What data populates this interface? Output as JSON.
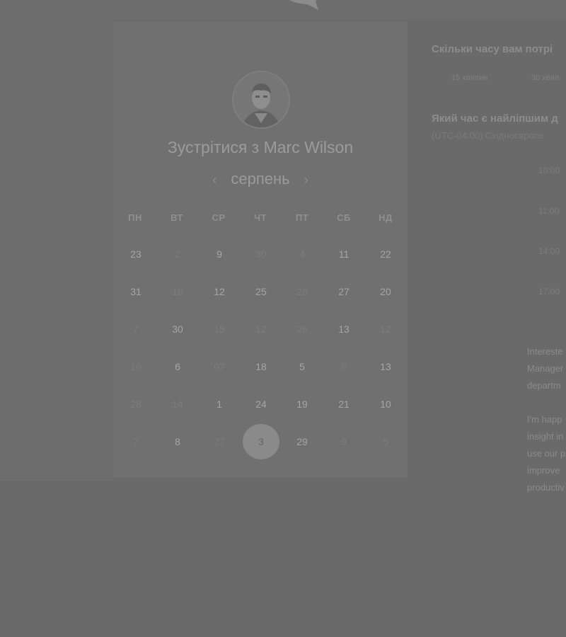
{
  "meeting": {
    "title": "Зустрітися з Marc Wilson"
  },
  "calendar": {
    "month": "серпень",
    "prev_icon": "chevron-left-icon",
    "next_icon": "chevron-right-icon",
    "weekdays": [
      "ПН",
      "ВТ",
      "СР",
      "ЧТ",
      "ПТ",
      "СБ",
      "НД"
    ],
    "weeks": [
      [
        {
          "label": "23",
          "dim": false
        },
        {
          "label": "2",
          "dim": true
        },
        {
          "label": "9",
          "dim": false
        },
        {
          "label": "30",
          "dim": true
        },
        {
          "label": "4",
          "dim": true
        },
        {
          "label": "11",
          "dim": false
        },
        {
          "label": "22",
          "dim": false
        }
      ],
      [
        {
          "label": "31",
          "dim": false
        },
        {
          "label": "16",
          "dim": true
        },
        {
          "label": "12",
          "dim": false
        },
        {
          "label": "25",
          "dim": false
        },
        {
          "label": "26",
          "dim": true
        },
        {
          "label": "27",
          "dim": false
        },
        {
          "label": "20",
          "dim": false
        }
      ],
      [
        {
          "label": "7",
          "dim": true
        },
        {
          "label": "30",
          "dim": false
        },
        {
          "label": "15",
          "dim": true
        },
        {
          "label": "12",
          "dim": true
        },
        {
          "label": "26",
          "dim": true
        },
        {
          "label": "13",
          "dim": false
        },
        {
          "label": "12",
          "dim": true
        }
      ],
      [
        {
          "label": "16",
          "dim": true
        },
        {
          "label": "6",
          "dim": false
        },
        {
          "label": "07",
          "dim": true
        },
        {
          "label": "18",
          "dim": false
        },
        {
          "label": "5",
          "dim": false
        },
        {
          "label": "8",
          "dim": true
        },
        {
          "label": "13",
          "dim": false
        }
      ],
      [
        {
          "label": "28",
          "dim": true
        },
        {
          "label": "14",
          "dim": true
        },
        {
          "label": "1",
          "dim": false
        },
        {
          "label": "24",
          "dim": false
        },
        {
          "label": "19",
          "dim": false
        },
        {
          "label": "21",
          "dim": false
        },
        {
          "label": "10",
          "dim": false
        }
      ],
      [
        {
          "label": "7",
          "dim": true
        },
        {
          "label": "8",
          "dim": false
        },
        {
          "label": "27",
          "dim": true
        },
        {
          "label": "3",
          "dim": false,
          "selected": true
        },
        {
          "label": "29",
          "dim": false
        },
        {
          "label": "9",
          "dim": true
        },
        {
          "label": "5",
          "dim": true
        }
      ]
    ]
  },
  "scheduler": {
    "duration_question": "Скільки часу вам потрі",
    "durations": [
      "15 хвилин",
      "30 хвил"
    ],
    "time_question": "Який час є найліпшим д",
    "timezone": "(UTC-04:00) Східноєвропе",
    "slots": [
      "10:00",
      "11:00",
      "14:00",
      "17:00"
    ]
  },
  "description": {
    "lines": [
      "Intereste",
      "Manager",
      "departm",
      "",
      "I'm happ",
      "insight in",
      "use our p",
      "improve",
      "productiv"
    ]
  },
  "colors": {
    "overlay": "#6a6a6a",
    "card": "#707070",
    "selected_day": "#8a8a8a"
  }
}
